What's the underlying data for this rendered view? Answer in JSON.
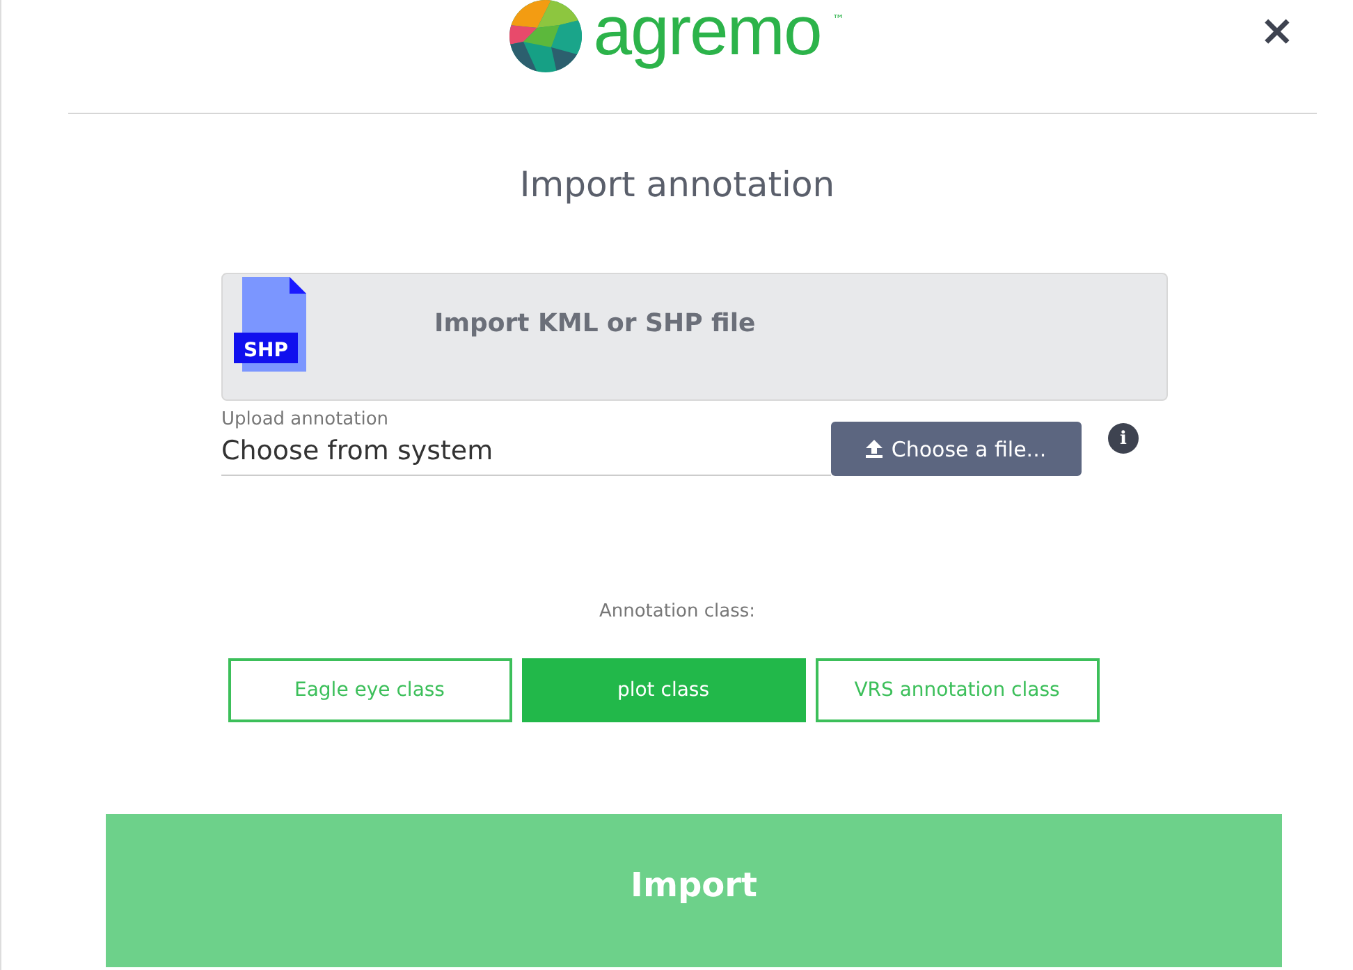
{
  "header": {
    "brand": "agremo",
    "trademark": "™",
    "close": "×"
  },
  "title": "Import annotation",
  "dropzone": {
    "file_type": "SHP",
    "text": "Import KML or SHP file"
  },
  "upload": {
    "label": "Upload annotation",
    "value": "Choose from system",
    "button": "Choose a file...",
    "info": "i"
  },
  "annotation_class": {
    "label": "Annotation class:",
    "options": [
      {
        "label": "Eagle eye class",
        "selected": false
      },
      {
        "label": "plot class",
        "selected": true
      },
      {
        "label": "VRS annotation class",
        "selected": false
      }
    ]
  },
  "submit": "Import"
}
